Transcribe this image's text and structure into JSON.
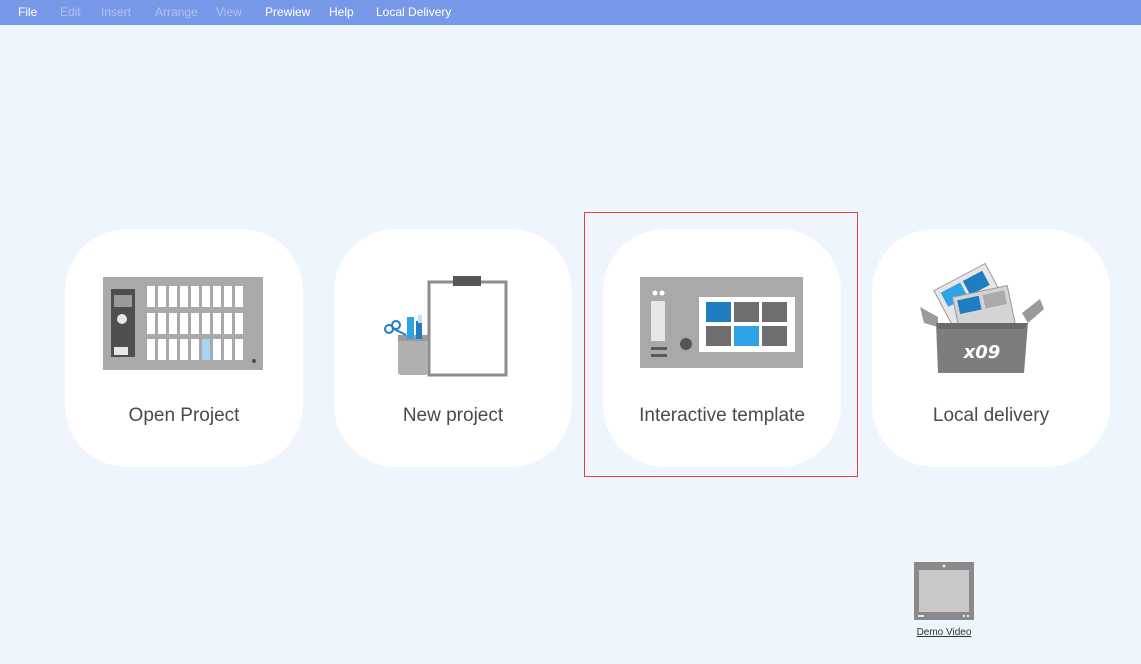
{
  "menu": {
    "items": [
      {
        "label": "File",
        "enabled": true
      },
      {
        "label": "Edit",
        "enabled": false
      },
      {
        "label": "Insert",
        "enabled": false
      },
      {
        "label": "Arrange",
        "enabled": false
      },
      {
        "label": "View",
        "enabled": false
      },
      {
        "label": "Prewiew",
        "enabled": true
      },
      {
        "label": "Help",
        "enabled": true
      },
      {
        "label": "Local Delivery",
        "enabled": true
      }
    ]
  },
  "cards": [
    {
      "label": "Open Project",
      "icon": "open-project-icon"
    },
    {
      "label": "New project",
      "icon": "new-project-icon"
    },
    {
      "label": "Interactive template",
      "icon": "interactive-template-icon",
      "selected": true
    },
    {
      "label": "Local delivery",
      "icon": "local-delivery-icon",
      "box_text": "x09"
    }
  ],
  "demo": {
    "label": "Demo Video",
    "icon": "video-tablet-icon"
  },
  "colors": {
    "menubar": "#7898ea",
    "background": "#eff5fd",
    "highlight": "#e0422f",
    "accent_blue": "#1f7dc1",
    "light_blue": "#2ea3e6"
  }
}
